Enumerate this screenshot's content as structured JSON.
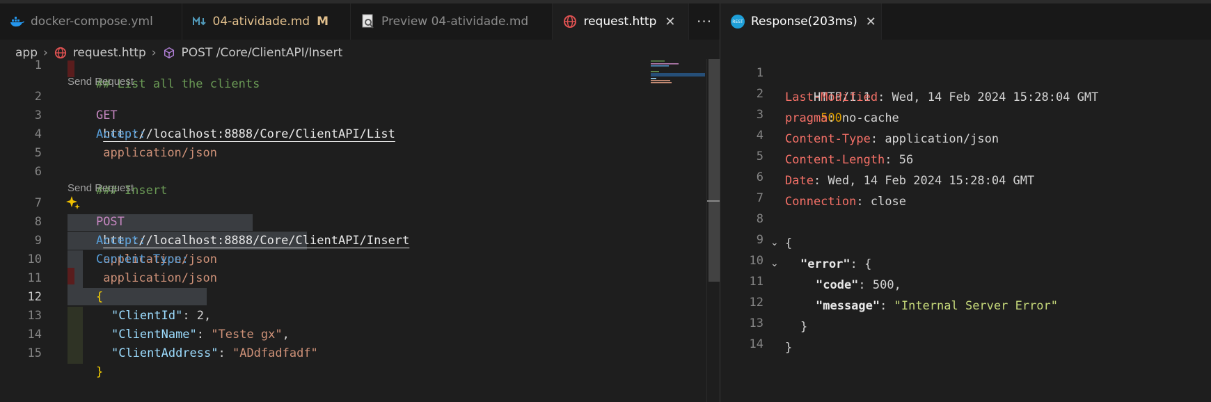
{
  "left_tabs": [
    {
      "label": "docker-compose.yml",
      "icon": "docker-icon"
    },
    {
      "label": "04-atividade.md",
      "modified": "M",
      "icon": "markdown-icon"
    },
    {
      "label": "Preview 04-atividade.md",
      "icon": "preview-icon"
    },
    {
      "label": "request.http",
      "icon": "globe-icon",
      "close": "✕"
    }
  ],
  "more_label": "···",
  "breadcrumb": {
    "root": "app",
    "file": "request.http",
    "symbol": "POST /Core/ClientAPI/Insert"
  },
  "editor": {
    "line_numbers": [
      "1",
      "2",
      "3",
      "4",
      "5",
      "6",
      "7",
      "8",
      "9",
      "10",
      "11",
      "12",
      "13",
      "14",
      "15"
    ],
    "code_lens": [
      "Send Request",
      "Send Request"
    ],
    "line1": "## List all the clients",
    "line2_method": "GET",
    "line2_url": "http://localhost:8888/Core/ClientAPI/List",
    "line3_key": "Accept:",
    "line3_val": "application/json",
    "line6": "### Insert",
    "line7_method": "POST",
    "line7_url": "http://localhost:8888/Core/ClientAPI/Insert",
    "line8_key": "Accept:",
    "line8_val": "application/json",
    "line9_key": "Content-Type:",
    "line9_val": "application/json",
    "line11": "{",
    "line12_key": "\"ClientId\"",
    "line12_rest": ": 2,",
    "line13_key": "\"ClientName\"",
    "line13_colon": ": ",
    "line13_val": "\"Teste gx\"",
    "line13_end": ",",
    "line14_key": "\"ClientAddress\"",
    "line14_colon": ": ",
    "line14_val": "\"ADdfadfadf\"",
    "line15": "}"
  },
  "response_tab": {
    "label": "Response(203ms)",
    "close": "✕",
    "icon": "rest-client-icon"
  },
  "response": {
    "line_numbers": [
      "1",
      "2",
      "3",
      "4",
      "5",
      "6",
      "7",
      "8",
      "9",
      "10",
      "11",
      "12",
      "13",
      "14"
    ],
    "status_proto": "HTTP/1.1",
    "status_code": "500",
    "headers": [
      {
        "key": "Last-Modified",
        "value": "Wed, 14 Feb 2024 15:28:04 GMT"
      },
      {
        "key": "pragma",
        "value": "no-cache"
      },
      {
        "key": "Content-Type",
        "value": "application/json"
      },
      {
        "key": "Content-Length",
        "value": "56"
      },
      {
        "key": "Date",
        "value": "Wed, 14 Feb 2024 15:28:04 GMT"
      },
      {
        "key": "Connection",
        "value": "close"
      }
    ],
    "body_open": "{",
    "error_key": "\"error\"",
    "error_open": ": {",
    "code_key": "\"code\"",
    "code_val": "500",
    "message_key": "\"message\"",
    "message_val": "\"Internal Server Error\"",
    "inner_close": "}",
    "body_close": "}"
  }
}
